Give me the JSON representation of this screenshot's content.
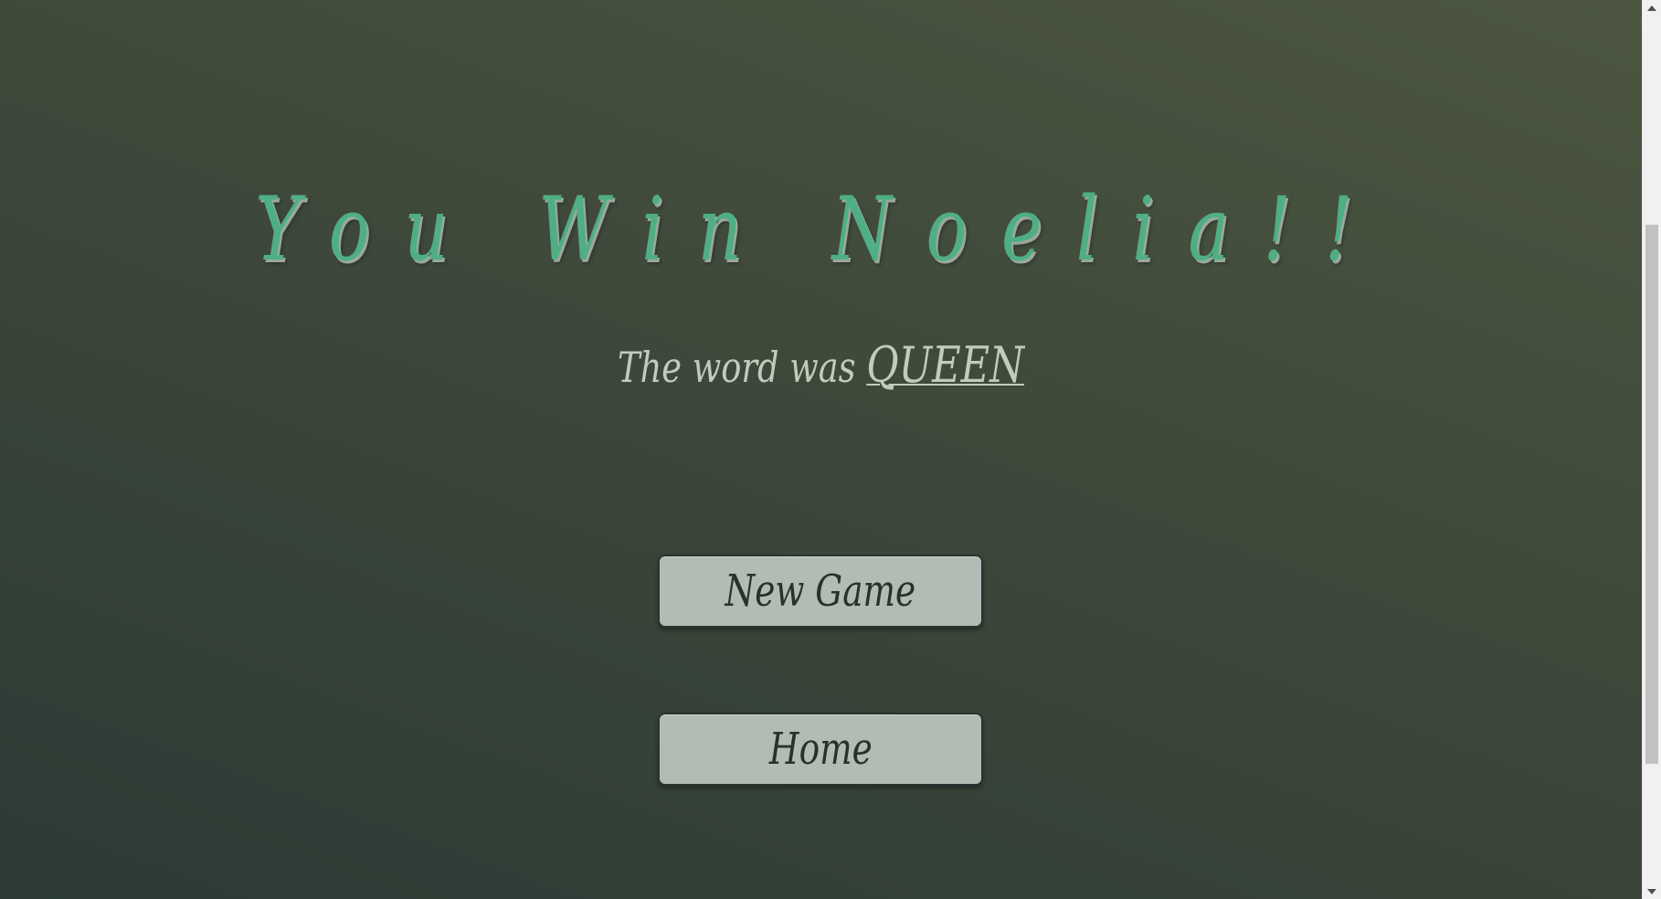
{
  "result": {
    "title": "You Win Noelia!!",
    "subtitle_prefix": "The word was",
    "word": "QUEEN"
  },
  "buttons": {
    "new_game_label": "New Game",
    "home_label": "Home"
  },
  "colors": {
    "title": "#4fae84",
    "title_shadow": "#9aa89d",
    "subtitle": "#c2cbbd",
    "button_bg": "#b1bdb4",
    "button_text": "#2a302c",
    "background_dark": "#2c3b36",
    "background_light": "#4c5640"
  },
  "icons": {
    "scroll_up": "chevron-up-icon",
    "scroll_down": "chevron-down-icon"
  }
}
